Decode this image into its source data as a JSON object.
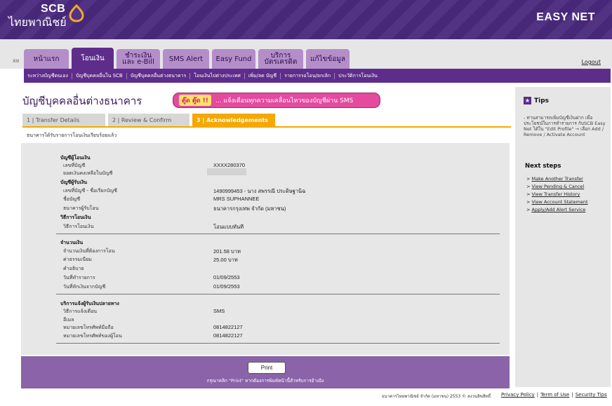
{
  "header": {
    "brand_en": "SCB",
    "brand_th": "ไทยพาณิชย์",
    "product": "EASY NET",
    "logo_color": "#f0a830"
  },
  "nav": {
    "corner_text": "XIII",
    "tabs": [
      {
        "line1": "หน้าแรก",
        "line2": ""
      },
      {
        "line1": "โอนเงิน",
        "line2": ""
      },
      {
        "line1": "ชำระเงิน",
        "line2": "และ e-Bill"
      },
      {
        "line1": "SMS Alert",
        "line2": ""
      },
      {
        "line1": "Easy Fund",
        "line2": ""
      },
      {
        "line1": "บริการ",
        "line2": "บัตรเครดิต"
      },
      {
        "line1": "แก้ไขข้อมูล",
        "line2": ""
      }
    ],
    "logout": "Logout",
    "subnav": [
      "ระหว่างบัญชีตนเอง",
      "บัญชีบุคคลอื่นใน SCB",
      "บัญชีบุคคลอื่นต่างธนาคาร",
      "โอนเงินไปต่างประเทศ",
      "เพิ่ม/ลด บัญชี",
      "รายการรอโอน/ยกเลิก",
      "ประวัติการโอนเงิน"
    ]
  },
  "page": {
    "title": "บัญชีบุคคลอื่นต่างธนาคาร",
    "promo_badge": "ตู๊ด ตู๊ด !!",
    "promo_text": "... แจ้งเตือนทุกความเคลื่อนไหวของบัญชีผ่าน SMS",
    "steps": [
      "1 | Transfer Details",
      "2 | Review & Confirm",
      "3 | Acknowledgements"
    ],
    "status": "ธนาคารได้รับรายการโอนเงินเรียบร้อยแล้ว"
  },
  "details": {
    "from_section": "บัญชีผู้โอนเงิน",
    "from_acct_label": "เลขที่บัญชี",
    "from_acct_value": "XXXX280370",
    "balance_label": "ยอดเงินคงเหลือในบัญชี",
    "to_section": "บัญชีผู้รับเงิน",
    "to_acct_label": "เลขที่บัญชี - ชื่อเรียกบัญชี",
    "to_acct_value": "1490999453 - นาง สพรรณี ประดิษฐานิฉ",
    "to_name_label": "ชื่อบัญชี",
    "to_name_value": "MRS SUPHANNEE",
    "to_bank_label": "ธนาคารผู้รับโอน",
    "to_bank_value": "ธนาคารกรุงเทพ จำกัด (มหาชน)",
    "method_section": "วิธีการโอนเงิน",
    "method_label": "วิธีการโอนเงิน",
    "method_value": "โอนแบบทันที",
    "amount_section": "จำนวนเงิน",
    "amount_label": "จำนวนเงินที่ต้องการโอน",
    "amount_value": "201.58 บาท",
    "fee_label": "ค่าธรรมเนียม",
    "fee_value": "25.00  บาท",
    "desc_label": "คำอธิบาย",
    "txn_date_label": "วันที่ทำรายการ",
    "txn_date_value": "01/09/2553",
    "debit_date_label": "วันที่หักเงินจากบัญชี",
    "debit_date_value": "01/09/2553",
    "notify_section": "บริการแจ้งผู้รับเงินปลายทาง",
    "notify_method_label": "วิธีการแจ้งเตือน",
    "notify_method_value": "SMS",
    "email_label": "อีเมล",
    "mobile_label": "หมายเลขโทรศัพท์มือถือ",
    "mobile_value": "0814822127",
    "sender_mobile_label": "หมายเลขโทรศัพท์ของผู้โอน",
    "sender_mobile_value": "0814822127"
  },
  "print": {
    "button": "Print",
    "note": "กรุณาคลิก \"Print\" หากต้องการพิมพ์หน้านี้สำหรับการอ้างอิง"
  },
  "sidebar": {
    "tips_title": "Tips",
    "tips_text": "- ท่านสามารถเพิ่มบัญชีเงินฝาก เพื่อประโยชน์ในการทำรายการ กับSCB Easy Net ได้ใน \"Edit Profile\" → เลือก Add / Remove / Activate Account",
    "next_title": "Next steps",
    "next_items": [
      "Make Another Transfer",
      "View Pending & Cancel",
      "View Transfer History",
      "View Account Statement",
      "Apply/Add Alert Service"
    ]
  },
  "footer": {
    "copyright": "ธนาคารไทยพาณิชย์ จำกัด (มหาชน) 2553 © สงวนลิขสิทธิ์",
    "links": [
      "Privacy Policy",
      "Term of Use",
      "Security Tips"
    ]
  }
}
